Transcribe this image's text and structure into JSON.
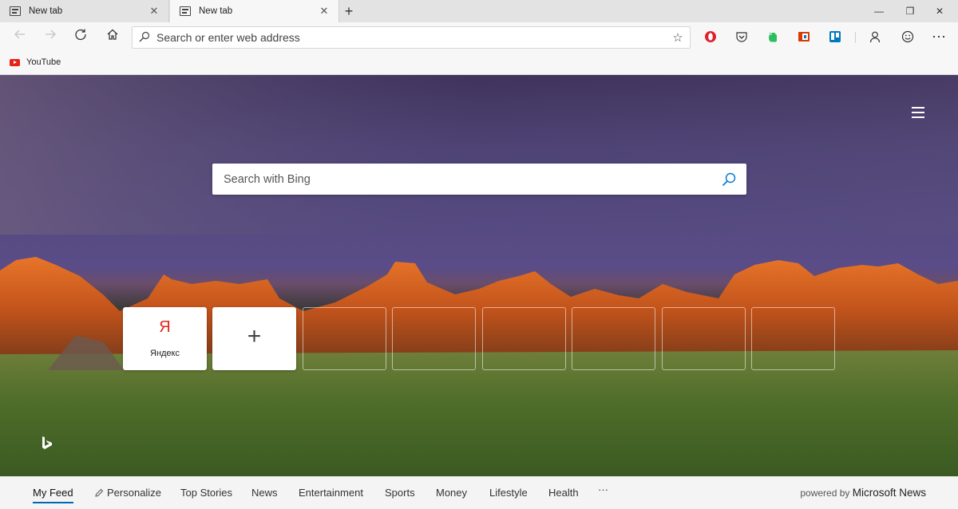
{
  "tabs": [
    {
      "label": "New tab",
      "close": "✕"
    },
    {
      "label": "New tab",
      "close": "✕"
    }
  ],
  "window": {
    "new_tab": "+",
    "minimize": "—",
    "restore": "❐",
    "close": "✕"
  },
  "address": {
    "placeholder": "Search or enter web address"
  },
  "favorites": [
    {
      "label": "YouTube"
    }
  ],
  "ntp": {
    "search_placeholder": "Search with Bing",
    "tiles": [
      {
        "logo": "Я",
        "label": "Яндекс"
      }
    ],
    "add_tile": "+"
  },
  "feed": {
    "items": [
      "My Feed",
      "Personalize",
      "Top Stories",
      "News",
      "Entertainment",
      "Sports",
      "Money",
      "Lifestyle",
      "Health",
      "···"
    ],
    "powered_prefix": "powered by",
    "powered_brand": "Microsoft News"
  },
  "colors": {
    "accent": "#0067b8",
    "youtube": "#e62117",
    "yandex": "#e1251b"
  },
  "icons": [
    "back-icon",
    "forward-icon",
    "refresh-icon",
    "home-icon",
    "search-icon",
    "star-icon",
    "opera-icon",
    "pocket-icon",
    "evernote-icon",
    "office-icon",
    "trello-icon",
    "profile-icon",
    "emoji-icon",
    "more-icon",
    "hamburger-icon",
    "bing-logo"
  ]
}
